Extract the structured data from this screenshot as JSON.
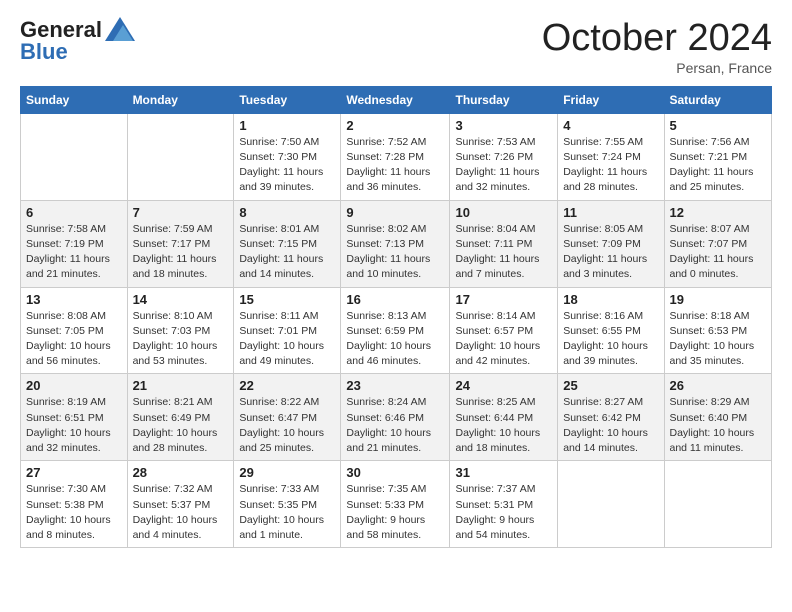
{
  "logo": {
    "line1": "General",
    "line2": "Blue"
  },
  "title": "October 2024",
  "location": "Persan, France",
  "days_header": [
    "Sunday",
    "Monday",
    "Tuesday",
    "Wednesday",
    "Thursday",
    "Friday",
    "Saturday"
  ],
  "weeks": [
    [
      {
        "day": "",
        "detail": ""
      },
      {
        "day": "",
        "detail": ""
      },
      {
        "day": "1",
        "detail": "Sunrise: 7:50 AM\nSunset: 7:30 PM\nDaylight: 11 hours and 39 minutes."
      },
      {
        "day": "2",
        "detail": "Sunrise: 7:52 AM\nSunset: 7:28 PM\nDaylight: 11 hours and 36 minutes."
      },
      {
        "day": "3",
        "detail": "Sunrise: 7:53 AM\nSunset: 7:26 PM\nDaylight: 11 hours and 32 minutes."
      },
      {
        "day": "4",
        "detail": "Sunrise: 7:55 AM\nSunset: 7:24 PM\nDaylight: 11 hours and 28 minutes."
      },
      {
        "day": "5",
        "detail": "Sunrise: 7:56 AM\nSunset: 7:21 PM\nDaylight: 11 hours and 25 minutes."
      }
    ],
    [
      {
        "day": "6",
        "detail": "Sunrise: 7:58 AM\nSunset: 7:19 PM\nDaylight: 11 hours and 21 minutes."
      },
      {
        "day": "7",
        "detail": "Sunrise: 7:59 AM\nSunset: 7:17 PM\nDaylight: 11 hours and 18 minutes."
      },
      {
        "day": "8",
        "detail": "Sunrise: 8:01 AM\nSunset: 7:15 PM\nDaylight: 11 hours and 14 minutes."
      },
      {
        "day": "9",
        "detail": "Sunrise: 8:02 AM\nSunset: 7:13 PM\nDaylight: 11 hours and 10 minutes."
      },
      {
        "day": "10",
        "detail": "Sunrise: 8:04 AM\nSunset: 7:11 PM\nDaylight: 11 hours and 7 minutes."
      },
      {
        "day": "11",
        "detail": "Sunrise: 8:05 AM\nSunset: 7:09 PM\nDaylight: 11 hours and 3 minutes."
      },
      {
        "day": "12",
        "detail": "Sunrise: 8:07 AM\nSunset: 7:07 PM\nDaylight: 11 hours and 0 minutes."
      }
    ],
    [
      {
        "day": "13",
        "detail": "Sunrise: 8:08 AM\nSunset: 7:05 PM\nDaylight: 10 hours and 56 minutes."
      },
      {
        "day": "14",
        "detail": "Sunrise: 8:10 AM\nSunset: 7:03 PM\nDaylight: 10 hours and 53 minutes."
      },
      {
        "day": "15",
        "detail": "Sunrise: 8:11 AM\nSunset: 7:01 PM\nDaylight: 10 hours and 49 minutes."
      },
      {
        "day": "16",
        "detail": "Sunrise: 8:13 AM\nSunset: 6:59 PM\nDaylight: 10 hours and 46 minutes."
      },
      {
        "day": "17",
        "detail": "Sunrise: 8:14 AM\nSunset: 6:57 PM\nDaylight: 10 hours and 42 minutes."
      },
      {
        "day": "18",
        "detail": "Sunrise: 8:16 AM\nSunset: 6:55 PM\nDaylight: 10 hours and 39 minutes."
      },
      {
        "day": "19",
        "detail": "Sunrise: 8:18 AM\nSunset: 6:53 PM\nDaylight: 10 hours and 35 minutes."
      }
    ],
    [
      {
        "day": "20",
        "detail": "Sunrise: 8:19 AM\nSunset: 6:51 PM\nDaylight: 10 hours and 32 minutes."
      },
      {
        "day": "21",
        "detail": "Sunrise: 8:21 AM\nSunset: 6:49 PM\nDaylight: 10 hours and 28 minutes."
      },
      {
        "day": "22",
        "detail": "Sunrise: 8:22 AM\nSunset: 6:47 PM\nDaylight: 10 hours and 25 minutes."
      },
      {
        "day": "23",
        "detail": "Sunrise: 8:24 AM\nSunset: 6:46 PM\nDaylight: 10 hours and 21 minutes."
      },
      {
        "day": "24",
        "detail": "Sunrise: 8:25 AM\nSunset: 6:44 PM\nDaylight: 10 hours and 18 minutes."
      },
      {
        "day": "25",
        "detail": "Sunrise: 8:27 AM\nSunset: 6:42 PM\nDaylight: 10 hours and 14 minutes."
      },
      {
        "day": "26",
        "detail": "Sunrise: 8:29 AM\nSunset: 6:40 PM\nDaylight: 10 hours and 11 minutes."
      }
    ],
    [
      {
        "day": "27",
        "detail": "Sunrise: 7:30 AM\nSunset: 5:38 PM\nDaylight: 10 hours and 8 minutes."
      },
      {
        "day": "28",
        "detail": "Sunrise: 7:32 AM\nSunset: 5:37 PM\nDaylight: 10 hours and 4 minutes."
      },
      {
        "day": "29",
        "detail": "Sunrise: 7:33 AM\nSunset: 5:35 PM\nDaylight: 10 hours and 1 minute."
      },
      {
        "day": "30",
        "detail": "Sunrise: 7:35 AM\nSunset: 5:33 PM\nDaylight: 9 hours and 58 minutes."
      },
      {
        "day": "31",
        "detail": "Sunrise: 7:37 AM\nSunset: 5:31 PM\nDaylight: 9 hours and 54 minutes."
      },
      {
        "day": "",
        "detail": ""
      },
      {
        "day": "",
        "detail": ""
      }
    ]
  ]
}
